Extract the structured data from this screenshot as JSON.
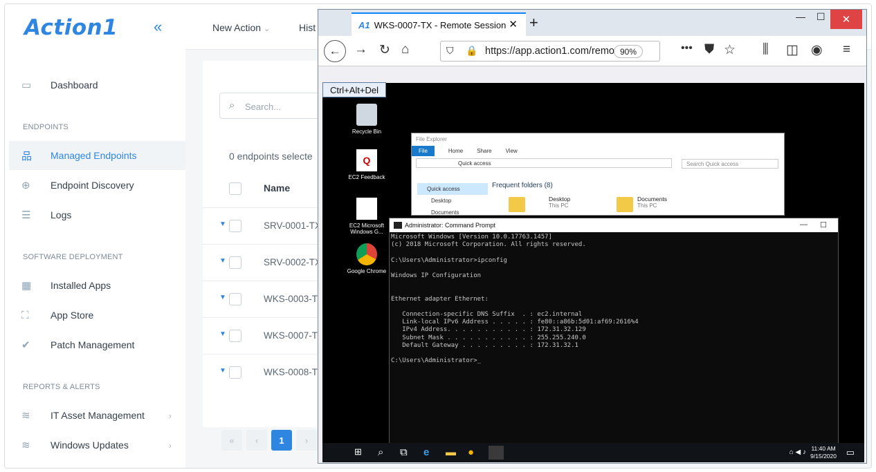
{
  "app": {
    "logo": "Action1",
    "collapse_glyph": "«"
  },
  "sidebar": {
    "dashboard": "Dashboard",
    "section_endpoints": "ENDPOINTS",
    "managed_endpoints": "Managed Endpoints",
    "endpoint_discovery": "Endpoint Discovery",
    "logs": "Logs",
    "section_software": "SOFTWARE DEPLOYMENT",
    "installed_apps": "Installed Apps",
    "app_store": "App Store",
    "patch_management": "Patch Management",
    "section_reports": "REPORTS & ALERTS",
    "it_asset_management": "IT Asset Management",
    "windows_updates": "Windows Updates"
  },
  "topbar": {
    "new_action": "New Action",
    "history": "Hist"
  },
  "endpoints": {
    "search_placeholder": "Search...",
    "selected_count": "0 endpoints selecte",
    "name_header": "Name",
    "rows": [
      "SRV-0001-TX",
      "SRV-0002-TX",
      "WKS-0003-T",
      "WKS-0007-TX",
      "WKS-0008-T"
    ]
  },
  "pagination": {
    "first": "«",
    "prev": "‹",
    "current": "1",
    "next": "›"
  },
  "browser": {
    "tab_logo": "A1",
    "tab_title": "WKS-0007-TX - Remote Session",
    "url": "https://app.action1.com/remote",
    "zoom": "90%",
    "ctrl_alt_del": "Ctrl+Alt+Del"
  },
  "remote_desktop": {
    "icons": [
      {
        "label": "Recycle Bin"
      },
      {
        "label": "EC2 Feedback"
      },
      {
        "label": "EC2 Microsoft Windows G..."
      },
      {
        "label": "Google Chrome"
      }
    ],
    "explorer": {
      "title": "File Explorer",
      "ribbon": [
        "File",
        "Home",
        "Share",
        "View"
      ],
      "address": "Quick access",
      "search": "Search Quick access",
      "nav": [
        "Quick access",
        "Desktop",
        "Documents"
      ],
      "frequent": "Frequent folders (8)",
      "folders": [
        {
          "name": "Desktop",
          "location": "This PC"
        },
        {
          "name": "Documents",
          "location": "This PC"
        }
      ]
    },
    "cmd": {
      "title": "Administrator: Command Prompt",
      "output": "Microsoft Windows [Version 10.0.17763.1457]\n(c) 2018 Microsoft Corporation. All rights reserved.\n\nC:\\Users\\Administrator>ipconfig\n\nWindows IP Configuration\n\n\nEthernet adapter Ethernet:\n\n   Connection-specific DNS Suffix  . : ec2.internal\n   Link-local IPv6 Address . . . . . : fe80::a86b:5d01:af69:2616%4\n   IPv4 Address. . . . . . . . . . . : 172.31.32.129\n   Subnet Mask . . . . . . . . . . . : 255.255.240.0\n   Default Gateway . . . . . . . . . : 172.31.32.1\n\nC:\\Users\\Administrator>_"
    },
    "taskbar": {
      "time": "11:40 AM",
      "date": "9/15/2020"
    }
  },
  "colors": {
    "brand": "#2f86e0",
    "firefox_accent": "#0a84ff",
    "window_close": "#e04343"
  }
}
